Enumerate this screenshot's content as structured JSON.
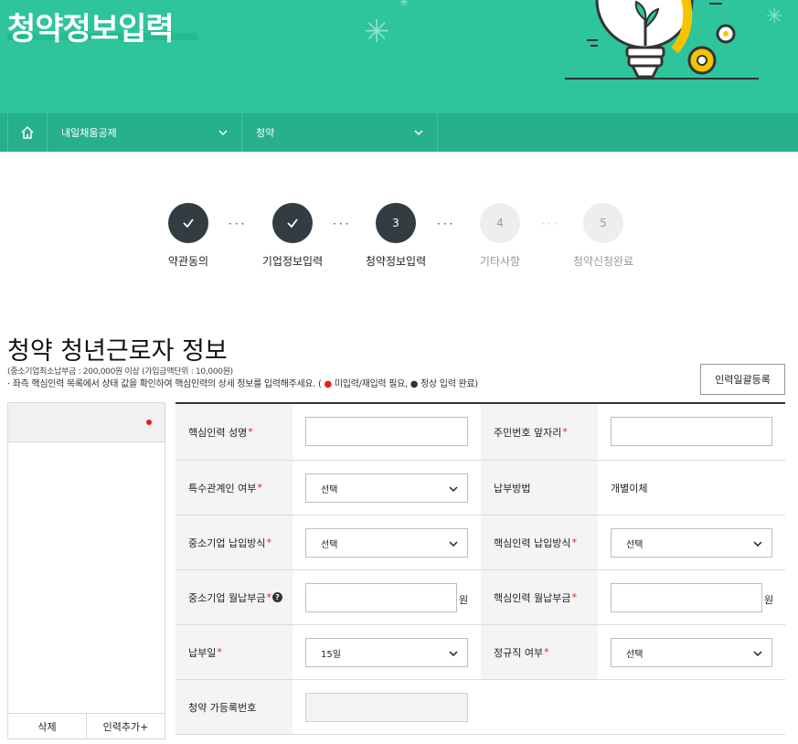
{
  "header": {
    "title": "청약정보입력"
  },
  "nav": {
    "home_icon": "home-icon",
    "menu1_label": "내일채움공제",
    "menu2_label": "청약"
  },
  "steps": [
    {
      "label": "약관동의",
      "state": "done"
    },
    {
      "label": "기업정보입력",
      "state": "done"
    },
    {
      "number": "3",
      "label": "청약정보입력",
      "state": "current"
    },
    {
      "number": "4",
      "label": "기타사항",
      "state": "todo"
    },
    {
      "number": "5",
      "label": "청약신청완료",
      "state": "todo"
    }
  ],
  "section": {
    "title": "청약 청년근로자 정보",
    "note_min": "(중소기업최소납부금 : 200,000원 이상 (가입금액단위 : 10,000원)",
    "note_guide_prefix": "· 좌측 핵심인력 목록에서 상태 값을 확인하여 핵심인력의 상세 정보를 입력해주세요. (",
    "note_guide_red": "미입력/재입력 필요,",
    "note_guide_dark": "정상 입력 완료)",
    "bulk_button": "인력일괄등록"
  },
  "left_panel": {
    "delete_button": "삭제",
    "add_button": "인력추가+"
  },
  "form": {
    "core_name_label": "핵심인력 성명",
    "core_name_value": "",
    "rrn_front_label": "주민번호 앞자리",
    "rrn_front_value": "",
    "special_relation_label": "특수관계인 여부",
    "special_relation_value": "선택",
    "payment_method_label": "납부방법",
    "payment_method_value": "개별이체",
    "sme_payment_type_label": "중소기업 납입방식",
    "sme_payment_type_value": "선택",
    "core_payment_type_label": "핵심인력 납입방식",
    "core_payment_type_value": "선택",
    "sme_monthly_label": "중소기업 월납부금",
    "sme_monthly_value": "",
    "core_monthly_label": "핵심인력 월납부금",
    "core_monthly_value": "",
    "unit_won": "원",
    "payment_day_label": "납부일",
    "payment_day_value": "15일",
    "regular_label": "정규직 여부",
    "regular_value": "선택",
    "reg_number_label": "청약 가등록번호",
    "reg_number_value": "",
    "required_mark": "*",
    "help_mark": "?"
  },
  "colors": {
    "brand_green": "#2ec49c",
    "nav_green": "#26b08b",
    "step_dark": "#333c40",
    "required_red": "#e02020"
  }
}
